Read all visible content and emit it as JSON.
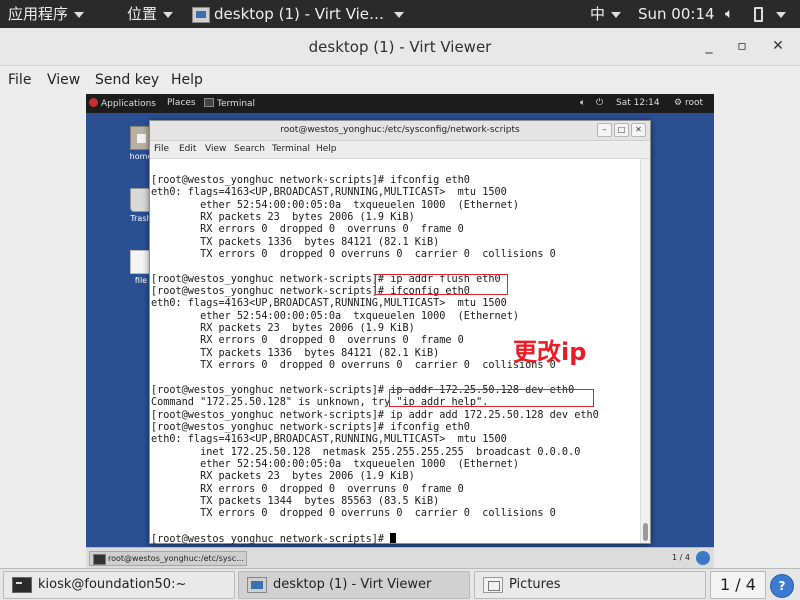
{
  "host_topbar": {
    "applications": "应用程序",
    "places": "位置",
    "active_window": "desktop (1) - Virt Vie…",
    "input_method": "中",
    "clock": "Sun 00:14"
  },
  "window": {
    "title": "desktop (1) - Virt Viewer"
  },
  "menubar": [
    "File",
    "View",
    "Send key",
    "Help"
  ],
  "guest": {
    "topbar": {
      "applications": "Applications",
      "places": "Places",
      "terminal": "Terminal",
      "clock": "Sat 12:14",
      "user": "root"
    },
    "desktop_icons": [
      "home",
      "Trash",
      "file"
    ],
    "terminal": {
      "title": "root@westos_yonghuc:/etc/sysconfig/network-scripts",
      "menu": [
        "File",
        "Edit",
        "View",
        "Search",
        "Terminal",
        "Help"
      ],
      "lines": [
        "[root@westos_yonghuc network-scripts]# ifconfig eth0",
        "eth0: flags=4163<UP,BROADCAST,RUNNING,MULTICAST>  mtu 1500",
        "        ether 52:54:00:00:05:0a  txqueuelen 1000  (Ethernet)",
        "        RX packets 23  bytes 2006 (1.9 KiB)",
        "        RX errors 0  dropped 0  overruns 0  frame 0",
        "        TX packets 1336  bytes 84121 (82.1 KiB)",
        "        TX errors 0  dropped 0 overruns 0  carrier 0  collisions 0",
        "",
        "[root@westos_yonghuc network-scripts]# ip addr flush eth0",
        "[root@westos_yonghuc network-scripts]# ifconfig eth0",
        "eth0: flags=4163<UP,BROADCAST,RUNNING,MULTICAST>  mtu 1500",
        "        ether 52:54:00:00:05:0a  txqueuelen 1000  (Ethernet)",
        "        RX packets 23  bytes 2006 (1.9 KiB)",
        "        RX errors 0  dropped 0  overruns 0  frame 0",
        "        TX packets 1336  bytes 84121 (82.1 KiB)",
        "        TX errors 0  dropped 0 overruns 0  carrier 0  collisions 0",
        "",
        "[root@westos_yonghuc network-scripts]# ip addr 172.25.50.128 dev eth0",
        "Command \"172.25.50.128\" is unknown, try \"ip addr help\".",
        "[root@westos_yonghuc network-scripts]# ip addr add 172.25.50.128 dev eth0",
        "[root@westos_yonghuc network-scripts]# ifconfig eth0",
        "eth0: flags=4163<UP,BROADCAST,RUNNING,MULTICAST>  mtu 1500",
        "        inet 172.25.50.128  netmask 255.255.255.255  broadcast 0.0.0.0",
        "        ether 52:54:00:00:05:0a  txqueuelen 1000  (Ethernet)",
        "        RX packets 23  bytes 2006 (1.9 KiB)",
        "        RX errors 0  dropped 0  overruns 0  frame 0",
        "        TX packets 1344  bytes 85563 (83.5 KiB)",
        "        TX errors 0  dropped 0 overruns 0  carrier 0  collisions 0",
        "",
        "[root@westos_yonghuc network-scripts]# "
      ]
    },
    "annotation": "更改ip",
    "taskbar": {
      "item": "root@westos_yonghuc:/etc/sysc...",
      "pager": "1 / 4"
    }
  },
  "host_taskbar": {
    "items": [
      "kiosk@foundation50:~",
      "desktop (1) - Virt Viewer",
      "Pictures"
    ],
    "pager": "1 / 4"
  },
  "colors": {
    "guest_desktop": "#2a4f93",
    "annotation_red": "#ee1a24",
    "host_topbar": "#2a2a2a"
  }
}
